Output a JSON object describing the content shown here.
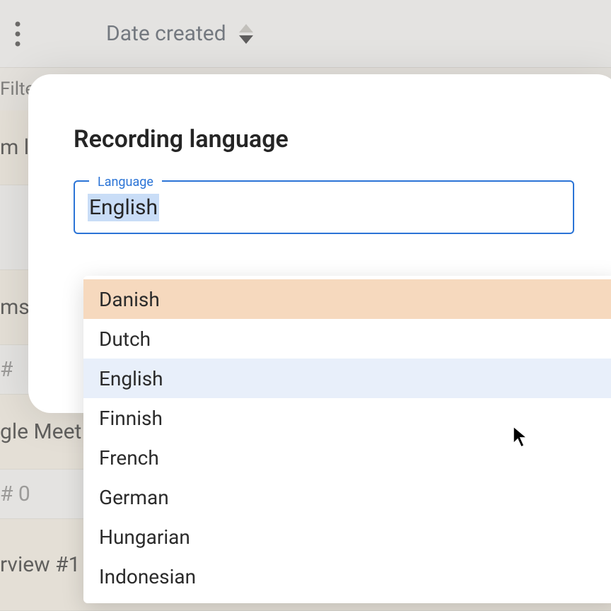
{
  "header": {
    "sort_label": "Date created"
  },
  "rows": {
    "filter": "Filte",
    "r1": "m l",
    "r2": "ms",
    "r3": "#",
    "r4": "gle Meet",
    "r5": "# 0",
    "r6": "rview #1"
  },
  "modal": {
    "title": "Recording language",
    "field_label": "Language",
    "field_value": "English"
  },
  "dropdown": {
    "options": [
      "Danish",
      "Dutch",
      "English",
      "Finnish",
      "French",
      "German",
      "Hungarian",
      "Indonesian"
    ],
    "hovered_index": 0,
    "selected_index": 2
  }
}
